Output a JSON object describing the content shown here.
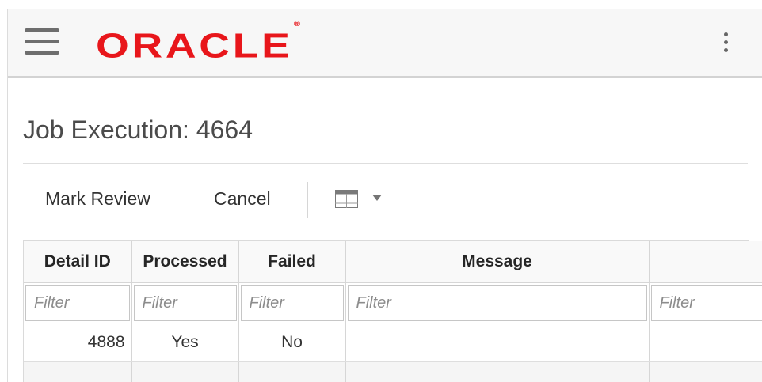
{
  "header": {
    "logo_text": "ORACLE",
    "logo_mark": "®",
    "logo_color": "#e8161b",
    "menu_icon": "hamburger-menu-icon",
    "more_icon": "vertical-ellipsis-icon"
  },
  "page": {
    "title": "Job Execution: 4664"
  },
  "toolbar": {
    "mark_review_label": "Mark Review",
    "cancel_label": "Cancel",
    "columns_icon": "table-grid-icon",
    "columns_caret": "caret-down-icon"
  },
  "table": {
    "columns": [
      "Detail ID",
      "Processed",
      "Failed",
      "Message",
      ""
    ],
    "filter_placeholder": "Filter",
    "rows": [
      {
        "detail_id": "4888",
        "processed": "Yes",
        "failed": "No",
        "message": "",
        "extra": ""
      }
    ]
  }
}
